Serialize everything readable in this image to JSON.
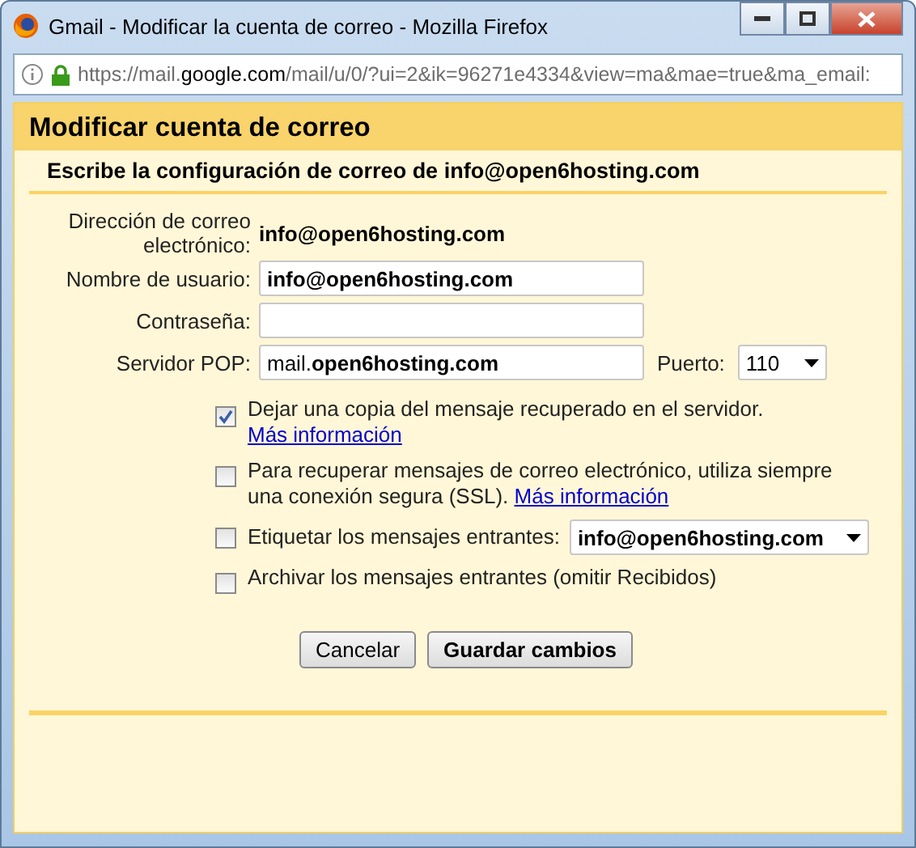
{
  "window": {
    "title": "Gmail - Modificar la cuenta de correo - Mozilla Firefox"
  },
  "address_bar": {
    "prefix": "https://mail.",
    "host": "google.com",
    "rest": "/mail/u/0/?ui=2&ik=96271e4334&view=ma&mae=true&ma_email:"
  },
  "dialog": {
    "title": "Modificar cuenta de correo",
    "subtitle": "Escribe la configuración de correo de",
    "account": "info@open6hosting.com"
  },
  "fields": [
    {
      "kind": "static",
      "label": "Dirección de correo electrónico:",
      "value": "info@open6hosting.com"
    },
    {
      "kind": "input",
      "label": "Nombre de usuario:",
      "value": "info@open6hosting.com"
    },
    {
      "kind": "input",
      "label": "Contraseña:"
    },
    {
      "kind": "server",
      "label": "Servidor POP:",
      "prefix": "mail.",
      "value": "open6hosting.com",
      "port_label": "Puerto:",
      "port": "110"
    }
  ],
  "options": [
    {
      "kind": "text",
      "checked": true,
      "text": "Dejar una copia del mensaje recuperado en el servidor.",
      "link": "Más información"
    },
    {
      "kind": "text",
      "checked": false,
      "text": "Para recuperar mensajes de correo electrónico, utiliza siempre una conexión segura (SSL).",
      "link": "Más información"
    },
    {
      "kind": "select",
      "checked": false,
      "text": "Etiquetar los mensajes entrantes:",
      "value": "info@open6hosting.com"
    },
    {
      "kind": "text",
      "checked": false,
      "text": "Archivar los mensajes entrantes (omitir Recibidos)"
    }
  ],
  "buttons": [
    {
      "kind": "normal",
      "label": "Cancelar"
    },
    {
      "kind": "primary",
      "label": "Guardar cambios"
    }
  ]
}
